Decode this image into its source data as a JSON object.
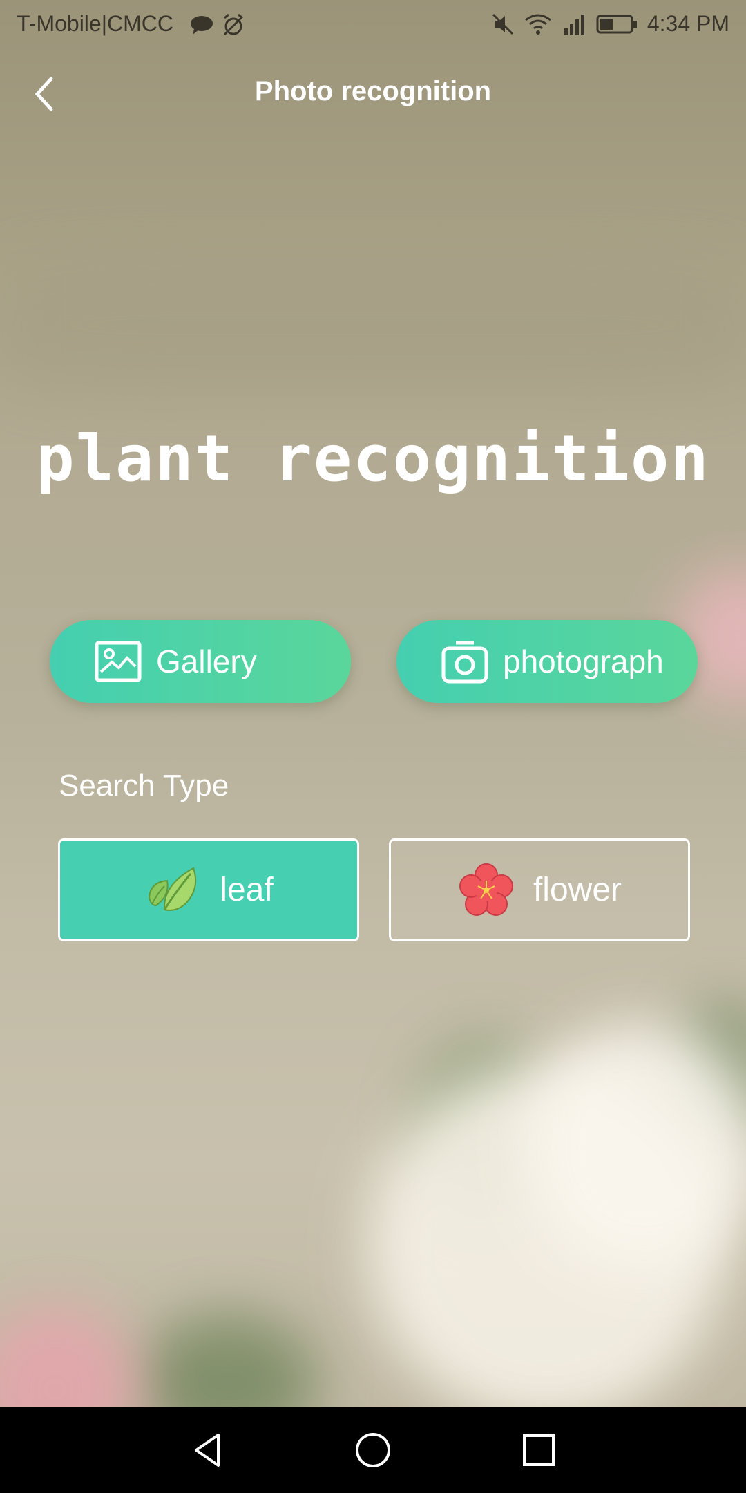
{
  "status_bar": {
    "carrier": "T-Mobile|CMCC",
    "time": "4:34 PM",
    "icons": [
      "chat-icon",
      "alarm-off-icon",
      "mute-icon",
      "wifi-icon",
      "signal-icon",
      "battery-icon"
    ]
  },
  "header": {
    "title": "Photo recognition",
    "back_icon": "chevron-left-icon"
  },
  "hero": {
    "title": "plant recognition"
  },
  "actions": {
    "gallery_label": "Gallery",
    "gallery_icon": "image-icon",
    "photograph_label": "photograph",
    "photograph_icon": "camera-icon"
  },
  "search_type": {
    "label": "Search Type",
    "options": [
      {
        "label": "leaf",
        "icon": "leaf-icon",
        "selected": true
      },
      {
        "label": "flower",
        "icon": "flower-icon",
        "selected": false
      }
    ]
  },
  "colors": {
    "accent": "#47cfb2",
    "pill_gradient_end": "#5ad69b",
    "navbar": "#000000"
  },
  "nav_bar": {
    "icons": [
      "nav-back-icon",
      "nav-home-icon",
      "nav-recent-icon"
    ]
  }
}
